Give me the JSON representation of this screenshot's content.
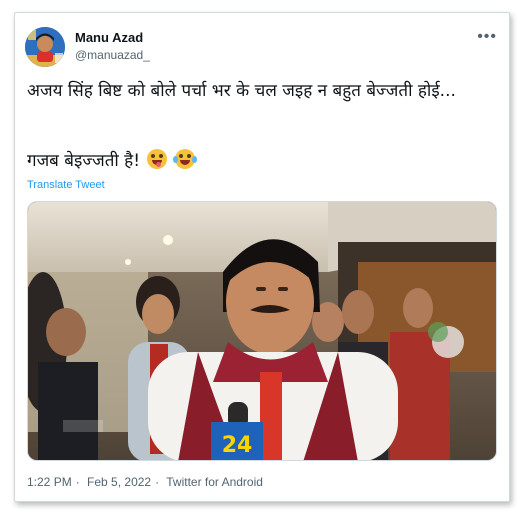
{
  "user": {
    "display_name": "Manu Azad",
    "handle": "@manuazad_"
  },
  "header": {
    "more_icon": "more-horizontal-icon",
    "more_glyph": "•••"
  },
  "tweet": {
    "line1": "अजय सिंह बिष्ट को बोले पर्चा भर के चल जइह न बहुत बेज्जती होई...",
    "line2": "गजब बेइज्जती है!",
    "emojis": [
      "winking-tongue-emoji",
      "tears-of-joy-emoji"
    ],
    "translate_label": "Translate Tweet"
  },
  "media": {
    "type": "video-frame",
    "mic_label": "24"
  },
  "meta": {
    "time": "1:22 PM",
    "separator": "·",
    "date": "Feb 5, 2022",
    "source": "Twitter for Android"
  },
  "colors": {
    "link": "#1d9bf0",
    "secondary_text": "#536471",
    "border": "#cfd9de"
  }
}
